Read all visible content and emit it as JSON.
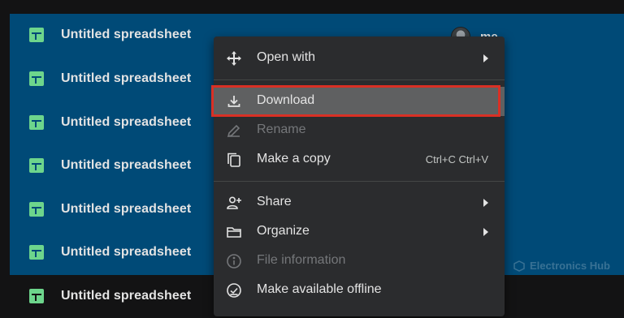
{
  "files": [
    {
      "name": "Untitled spreadsheet"
    },
    {
      "name": "Untitled spreadsheet"
    },
    {
      "name": "Untitled spreadsheet"
    },
    {
      "name": "Untitled spreadsheet"
    },
    {
      "name": "Untitled spreadsheet"
    },
    {
      "name": "Untitled spreadsheet"
    },
    {
      "name": "Untitled spreadsheet"
    }
  ],
  "owner": {
    "label": "me"
  },
  "context_menu": {
    "open_with": "Open with",
    "download": "Download",
    "rename": "Rename",
    "make_copy": "Make a copy",
    "make_copy_shortcut": "Ctrl+C Ctrl+V",
    "share": "Share",
    "organize": "Organize",
    "file_information": "File information",
    "make_available_offline": "Make available offline"
  },
  "watermark": {
    "text": "Electronics Hub"
  },
  "colors": {
    "selection": "#004a77",
    "menu_bg": "#2b2c2e",
    "highlight_border": "#d93025",
    "sheets_green": "#6dd58c"
  },
  "icons": {
    "open_with": "move-arrows-icon",
    "download": "download-icon",
    "rename": "pencil-icon",
    "make_copy": "copy-icon",
    "share": "person-add-icon",
    "organize": "folder-icon",
    "file_information": "info-icon",
    "make_available_offline": "offline-check-icon",
    "file": "sheets-icon"
  }
}
